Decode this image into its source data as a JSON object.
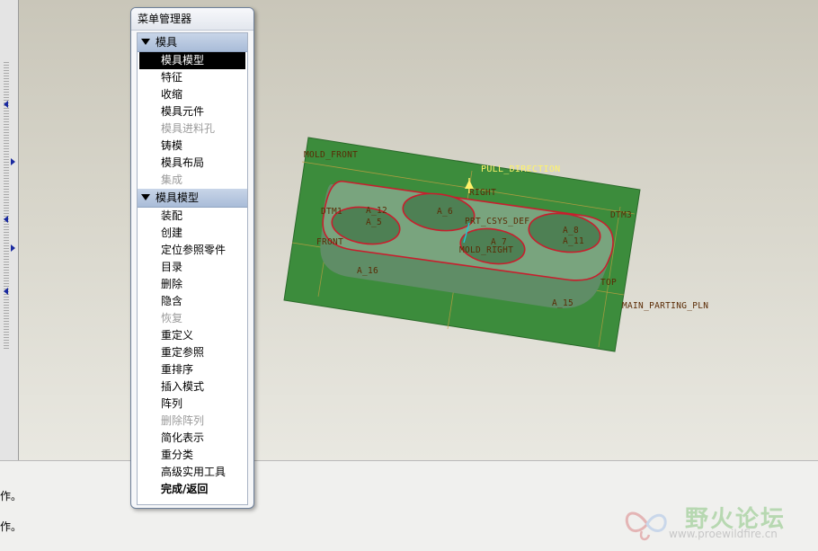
{
  "menu": {
    "title": "菜单管理器",
    "sections": [
      {
        "header": "模具",
        "items": [
          "模具模型",
          "特征",
          "收缩",
          "模具元件",
          "模具进料孔",
          "铸模",
          "模具布局",
          "集成"
        ]
      },
      {
        "header": "模具模型",
        "items": [
          "装配",
          "创建",
          "定位参照零件",
          "目录",
          "删除",
          "隐含",
          "恢复",
          "重定义",
          "重定参照",
          "重排序",
          "插入模式",
          "阵列",
          "删除阵列",
          "简化表示",
          "重分类",
          "高级实用工具",
          "完成/返回"
        ]
      }
    ]
  },
  "viewport": {
    "labels": {
      "mold_front": "MOLD_FRONT",
      "pull_direction": "PULL_DIRECTION",
      "right": "RIGHT",
      "dtm1": "DTM1",
      "a12": "A_12",
      "a5": "A_5",
      "a6": "A_6",
      "prt_csys": "PRT_CSYS_DEF",
      "dtm3": "DTM3",
      "front": "FRONT",
      "a7": "A_7",
      "a8": "A_8",
      "a11": "A_11",
      "mold_right": "MOLD_RIGHT",
      "a16": "A_16",
      "top": "TOP",
      "a15": "A_15",
      "main_parting": "MAIN_PARTING_PLN"
    },
    "colors": {
      "plane": "#3f8f3f",
      "part": "#6f9c74",
      "edge": "#c81e2d",
      "datum_text": "#5a2b05"
    }
  },
  "messages": [
    "作。",
    "作。"
  ],
  "watermark": {
    "title": "野火论坛",
    "url": "www.proewildfire.cn"
  }
}
